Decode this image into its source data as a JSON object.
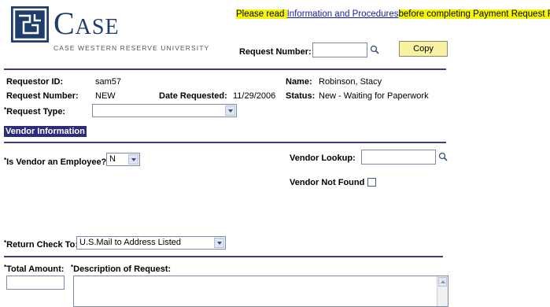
{
  "header": {
    "logo_text": "Case",
    "logo_subtitle": "CASE WESTERN RESERVE UNIVERSITY",
    "notice_prefix": "Please read ",
    "notice_link": "Information and Procedures",
    "notice_suffix": "before completing Payment Request Form"
  },
  "request": {
    "request_number_label": "Request Number:",
    "request_number_value": "",
    "copy_label": "Copy"
  },
  "summary": {
    "requestor_id_label": "Requestor ID:",
    "requestor_id_value": "sam57",
    "name_label": "Name:",
    "name_value": "Robinson, Stacy",
    "request_number_label": "Request Number:",
    "request_number_value": "NEW",
    "date_requested_label": "Date Requested:",
    "date_requested_value": "11/29/2006",
    "status_label": "Status:",
    "status_value": "New - Waiting for Paperwork",
    "request_type_label": "Request Type:",
    "request_type_value": ""
  },
  "vendor": {
    "section_title": "Vendor Information",
    "is_employee_label": "Is Vendor an Employee?",
    "is_employee_value": "N",
    "lookup_label": "Vendor Lookup:",
    "lookup_value": "",
    "not_found_label": "Vendor Not Found"
  },
  "return_check": {
    "label": "Return Check To:",
    "value": "U.S.Mail to Address Listed"
  },
  "amount": {
    "total_label": "Total Amount:",
    "total_value": "",
    "description_label": "Description of Request:",
    "description_value": ""
  },
  "required_marker": "*",
  "colors": {
    "brand_navy": "#1e3c6e",
    "rule": "#3b3d7c",
    "highlight": "#f6f600",
    "button": "#f7f3a2"
  },
  "icons": {
    "lookup": "magnifier-icon",
    "dropdown": "chevron-down-icon",
    "scroll_up": "arrow-up-icon"
  }
}
